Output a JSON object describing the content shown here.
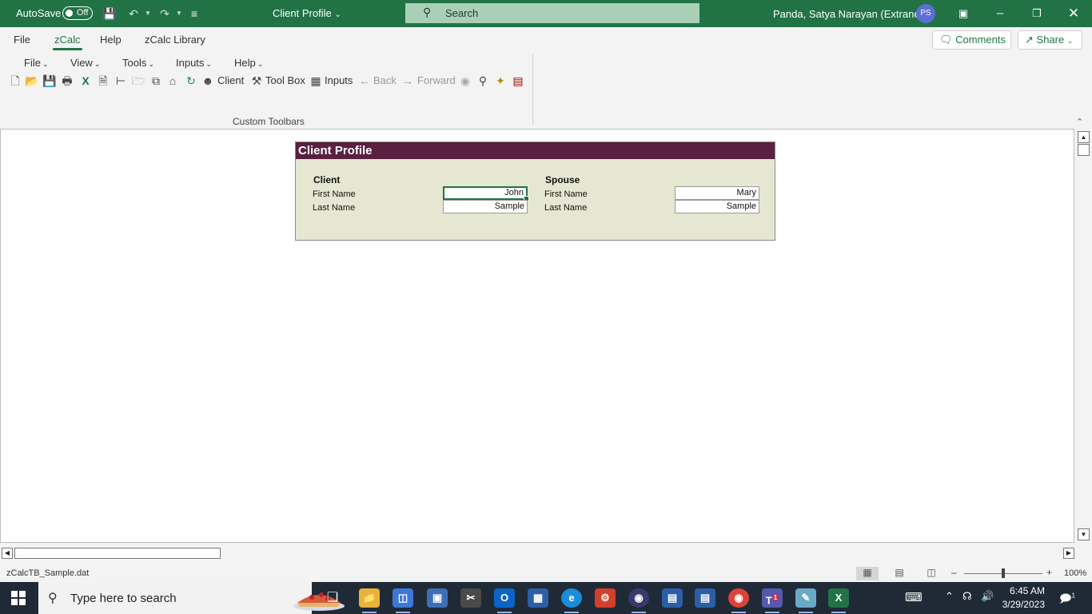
{
  "titlebar": {
    "autosave_label": "AutoSave",
    "autosave_state": "Off",
    "doc_title": "Client Profile",
    "search_placeholder": "Search",
    "user_name": "Panda, Satya Narayan (Extranet)",
    "user_initials": "PS"
  },
  "ribbon": {
    "tabs": [
      "File",
      "zCalc",
      "Help",
      "zCalc Library"
    ],
    "active_tab": "zCalc",
    "comments_label": "Comments",
    "share_label": "Share",
    "menus": [
      "File",
      "View",
      "Tools",
      "Inputs",
      "Help"
    ],
    "toolbar": {
      "client_label": "Client",
      "toolbox_label": "Tool Box",
      "inputs_label": "Inputs",
      "back_label": "Back",
      "forward_label": "Forward"
    },
    "group_label": "Custom Toolbars"
  },
  "form": {
    "title": "Client Profile",
    "client": {
      "heading": "Client",
      "first_name_label": "First Name",
      "first_name": "John",
      "last_name_label": "Last Name",
      "last_name": "Sample"
    },
    "spouse": {
      "heading": "Spouse",
      "first_name_label": "First Name",
      "first_name": "Mary",
      "last_name_label": "Last Name",
      "last_name": "Sample"
    }
  },
  "statusbar": {
    "filename": "zCalcTB_Sample.dat",
    "zoom": "100%"
  },
  "taskbar": {
    "search_placeholder": "Type here to search",
    "time": "6:45 AM",
    "date": "3/29/2023",
    "notification_count": "1",
    "teams_badge": "1"
  },
  "colors": {
    "excel_green": "#217346",
    "form_header": "#59203f",
    "form_body": "#e6e7d2"
  }
}
